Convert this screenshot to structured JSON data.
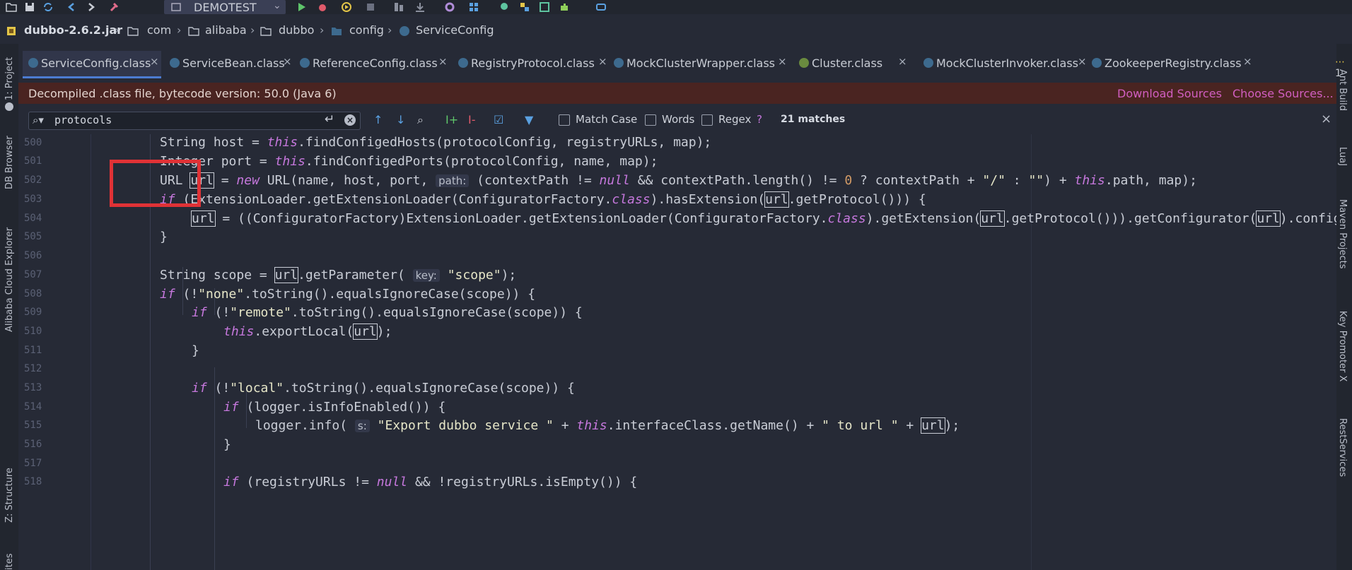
{
  "toolbar": {
    "run_config": "DEMOTEST",
    "icons": [
      "folder-icon",
      "save-icon",
      "sync-icon",
      "back-icon",
      "forward-icon",
      "build-hammer-icon",
      "run-icon",
      "debug-icon",
      "coverage-icon",
      "stop-icon",
      "vcs-update-icon",
      "vcs-push-icon",
      "settings-icon",
      "structure-icon",
      "search-icon",
      "project-structure-icon",
      "layout-icon",
      "plugins-icon",
      "cloud-icon"
    ]
  },
  "breadcrumb": {
    "jar": "dubbo-2.6.2.jar",
    "items": [
      "com",
      "alibaba",
      "dubbo",
      "config",
      "ServiceConfig"
    ]
  },
  "left_tools": [
    "1: Project",
    "DB Browser",
    "Alibaba Cloud Explorer",
    "Z: Structure",
    "ites"
  ],
  "right_tools": [
    "Ant Build",
    "LuaJ",
    "Maven Projects",
    "Key Promoter X",
    "RestServices"
  ],
  "tabs": [
    {
      "label": "ServiceConfig.class",
      "active": true
    },
    {
      "label": "ServiceBean.class"
    },
    {
      "label": "ReferenceConfig.class"
    },
    {
      "label": "RegistryProtocol.class"
    },
    {
      "label": "MockClusterWrapper.class"
    },
    {
      "label": "Cluster.class"
    },
    {
      "label": "MockClusterInvoker.class"
    },
    {
      "label": "ZookeeperRegistry.class"
    }
  ],
  "tab_more": "1",
  "banner": {
    "message": "Decompiled .class file, bytecode version: 50.0 (Java 6)",
    "download": "Download Sources",
    "choose": "Choose Sources..."
  },
  "search": {
    "query": "protocols",
    "match_case": "Match Case",
    "words": "Words",
    "regex": "Regex",
    "regex_help": "?",
    "matches": "21 matches"
  },
  "line_numbers": [
    "500",
    "501",
    "502",
    "503",
    "504",
    "505",
    "506",
    "507",
    "508",
    "509",
    "510",
    "511",
    "512",
    "513",
    "514",
    "515",
    "516",
    "517",
    "518"
  ],
  "colors": {
    "accent": "#4c7bd0",
    "annotation_red": "#e03236",
    "link": "#d15ec0",
    "banner_bg": "#4a2421"
  }
}
